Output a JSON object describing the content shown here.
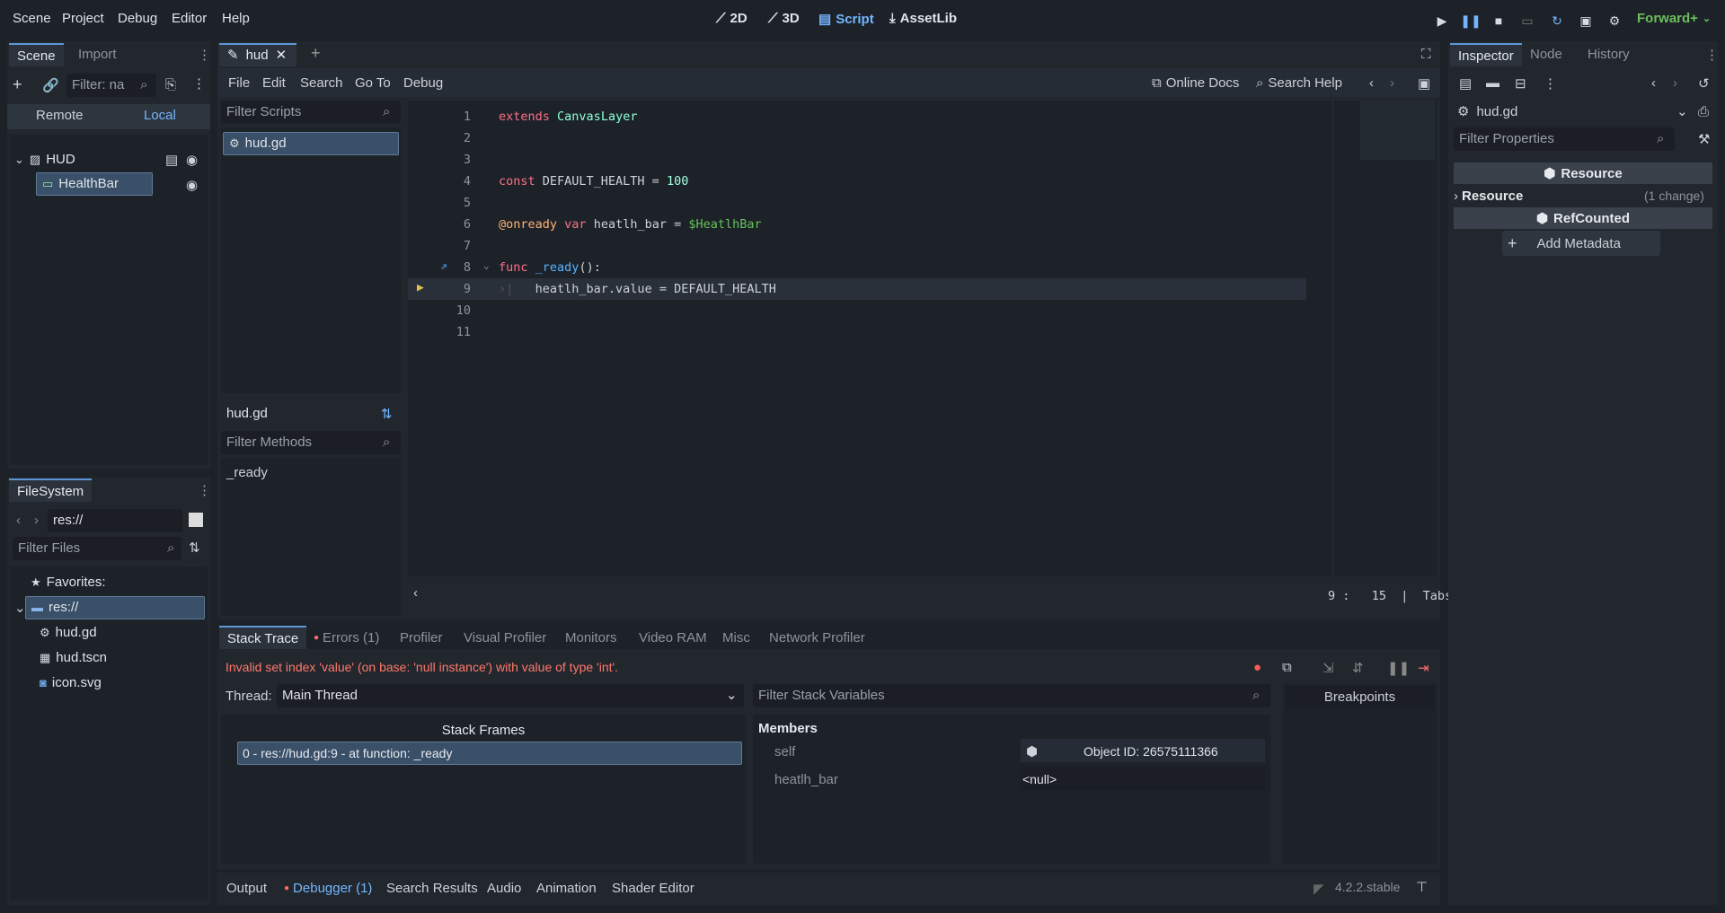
{
  "menubar": {
    "items": [
      "Scene",
      "Project",
      "Debug",
      "Editor",
      "Help"
    ],
    "workspaces": [
      "2D",
      "3D",
      "Script",
      "AssetLib"
    ],
    "renderer": "Forward+"
  },
  "scene_dock": {
    "tabs": [
      "Scene",
      "Import"
    ],
    "filter_placeholder": "Filter: na",
    "remote": "Remote",
    "local": "Local",
    "nodes": [
      "HUD",
      "HealthBar"
    ]
  },
  "filesystem": {
    "tab": "FileSystem",
    "path": "res://",
    "filter_placeholder": "Filter Files",
    "favorites": "Favorites:",
    "items": [
      "res://",
      "hud.gd",
      "hud.tscn",
      "icon.svg"
    ]
  },
  "script_editor": {
    "tab": "hud",
    "menu": [
      "File",
      "Edit",
      "Search",
      "Go To",
      "Debug"
    ],
    "online_docs": "Online Docs",
    "search_help": "Search Help",
    "filter_scripts": "Filter Scripts",
    "scripts": [
      "hud.gd"
    ],
    "current_script": "hud.gd",
    "filter_methods": "Filter Methods",
    "methods": [
      "_ready"
    ],
    "line_numbers": [
      "1",
      "2",
      "3",
      "4",
      "5",
      "6",
      "7",
      "8",
      "9",
      "10",
      "11"
    ],
    "status": "9 :   15  |  Tabs"
  },
  "debugger": {
    "tabs": [
      "Stack Trace",
      "Errors (1)",
      "Profiler",
      "Visual Profiler",
      "Monitors",
      "Video RAM",
      "Misc",
      "Network Profiler"
    ],
    "error": "Invalid set index 'value' (on base: 'null instance') with value of type 'int'.",
    "thread_label": "Thread:",
    "thread_value": "Main Thread",
    "stack_frames_header": "Stack Frames",
    "frame": "0 - res://hud.gd:9 - at function: _ready",
    "filter_vars": "Filter Stack Variables",
    "members": "Members",
    "vars": [
      {
        "name": "self",
        "value": "Object ID: 26575111366"
      },
      {
        "name": "heatlh_bar",
        "value": "<null>"
      }
    ],
    "breakpoints": "Breakpoints"
  },
  "bottom_bar": {
    "tabs": [
      "Output",
      "Debugger (1)",
      "Search Results",
      "Audio",
      "Animation",
      "Shader Editor"
    ],
    "version": "4.2.2.stable"
  },
  "inspector": {
    "tabs": [
      "Inspector",
      "Node",
      "History"
    ],
    "resource_name": "hud.gd",
    "filter_placeholder": "Filter Properties",
    "section_resource": "Resource",
    "resource_row": "Resource",
    "resource_change": "(1 change)",
    "section_refcounted": "RefCounted",
    "add_metadata": "Add Metadata"
  }
}
